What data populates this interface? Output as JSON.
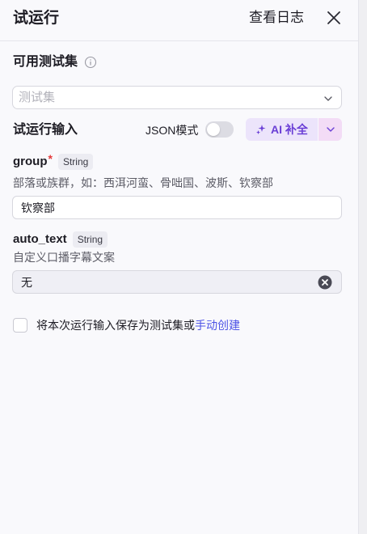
{
  "header": {
    "title": "试运行",
    "logs_label": "查看日志"
  },
  "testset": {
    "label": "可用测试集",
    "placeholder": "测试集"
  },
  "run_input": {
    "label": "试运行输入",
    "json_mode_label": "JSON模式",
    "json_mode_on": false,
    "ai_button_label": "AI 补全"
  },
  "fields": [
    {
      "name": "group",
      "required_mark": "*",
      "type": "String",
      "description": "部落或族群，如：西洱河蛮、骨咄国、波斯、钦察部",
      "value": "钦察部"
    },
    {
      "name": "auto_text",
      "type": "String",
      "description": "自定义口播字幕文案",
      "value": "无"
    }
  ],
  "save": {
    "text": "将本次运行输入保存为测试集或",
    "link": "手动创建"
  },
  "colors": {
    "accent": "#6a3fd6",
    "link": "#4e54e6",
    "required": "#e5393a"
  }
}
